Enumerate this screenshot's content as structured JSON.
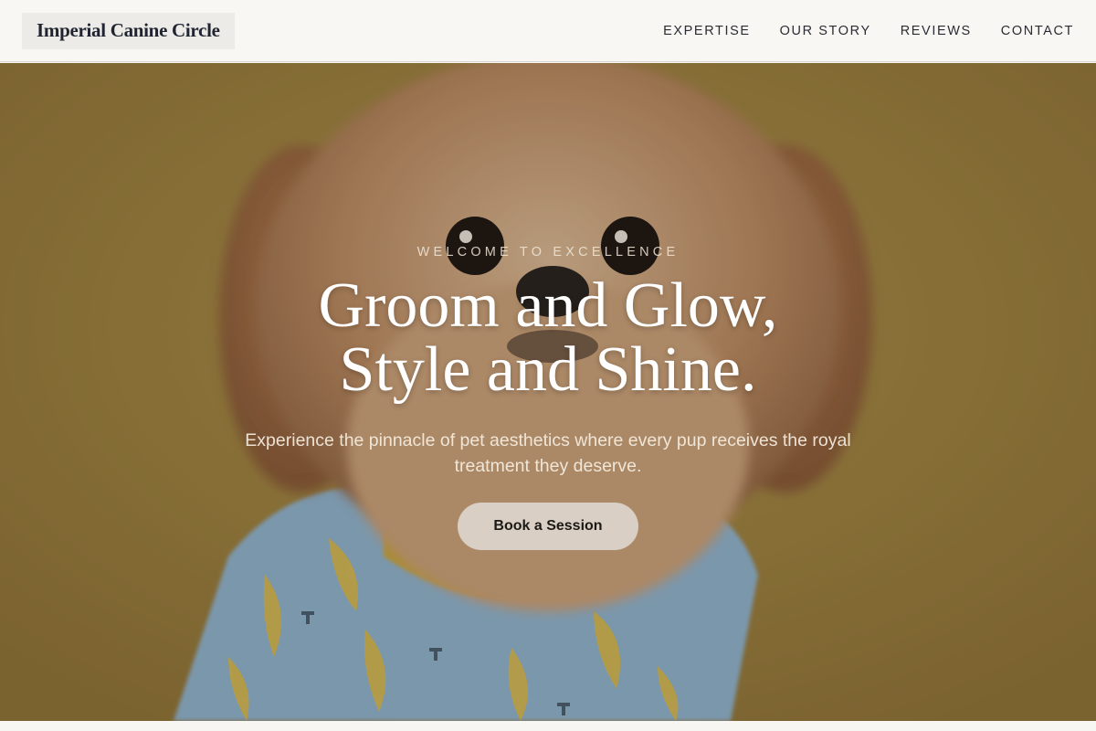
{
  "site": {
    "brand": "Imperial Canine Circle"
  },
  "nav": {
    "items": [
      {
        "label": "EXPERTISE"
      },
      {
        "label": "OUR STORY"
      },
      {
        "label": "REVIEWS"
      },
      {
        "label": "CONTACT"
      }
    ]
  },
  "hero": {
    "eyebrow": "WELCOME TO EXCELLENCE",
    "headline_line1": "Groom and Glow,",
    "headline_line2": "Style and Shine.",
    "subhead": "Experience the pinnacle of pet aesthetics where every pup receives the royal treatment they deserve.",
    "cta_label": "Book a Session",
    "image_subject": "fluffy dog in blue banana-print shirt on mustard background"
  },
  "colors": {
    "header_bg": "#f8f7f3",
    "hero_bg": "#a48845",
    "cta_bg": "#d9cfc4",
    "text_dark": "#1f2430"
  }
}
